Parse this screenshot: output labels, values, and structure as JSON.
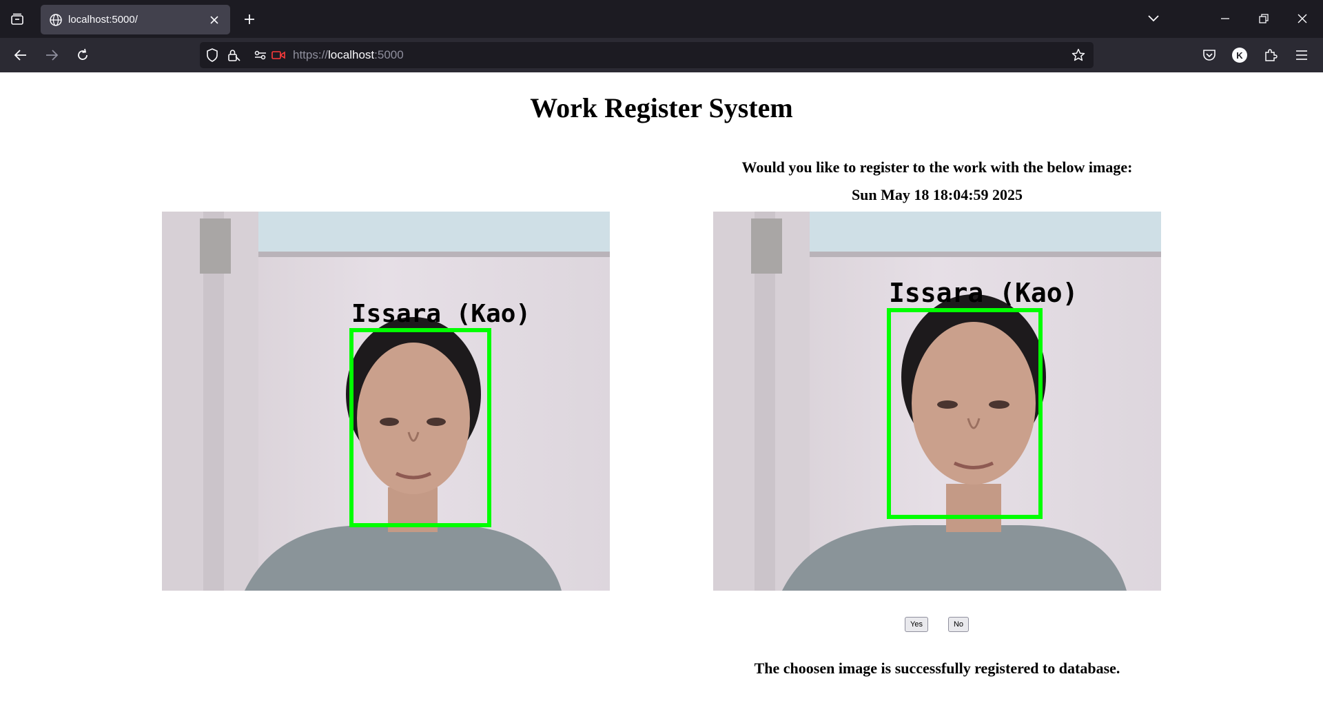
{
  "browser": {
    "tab_title": "localhost:5000/",
    "url_scheme": "https://",
    "url_host": "localhost",
    "url_port": ":5000",
    "profile_initial": "K"
  },
  "page": {
    "title": "Work Register System",
    "question": "Would you like to register to the work with the below image:",
    "timestamp": "Sun May 18 18:04:59 2025",
    "left_image_label": "Issara (Kao)",
    "right_image_label": "Issara (Kao)",
    "yes_label": "Yes",
    "no_label": "No",
    "status": "The choosen image is successfully registered to database."
  },
  "colors": {
    "detection_box": "#00ff00",
    "chrome_dark": "#1c1b22",
    "chrome_mid": "#2b2a33"
  }
}
